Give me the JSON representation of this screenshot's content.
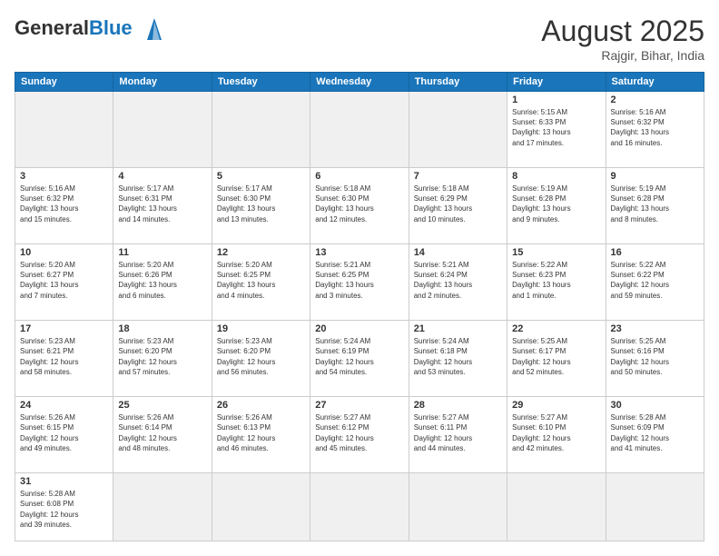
{
  "header": {
    "logo_general": "General",
    "logo_blue": "Blue",
    "month_title": "August 2025",
    "location": "Rajgir, Bihar, India"
  },
  "weekdays": [
    "Sunday",
    "Monday",
    "Tuesday",
    "Wednesday",
    "Thursday",
    "Friday",
    "Saturday"
  ],
  "days": {
    "1": {
      "sunrise": "5:15 AM",
      "sunset": "6:33 PM",
      "daylight": "13 hours and 17 minutes."
    },
    "2": {
      "sunrise": "5:16 AM",
      "sunset": "6:32 PM",
      "daylight": "13 hours and 16 minutes."
    },
    "3": {
      "sunrise": "5:16 AM",
      "sunset": "6:32 PM",
      "daylight": "13 hours and 15 minutes."
    },
    "4": {
      "sunrise": "5:17 AM",
      "sunset": "6:31 PM",
      "daylight": "13 hours and 14 minutes."
    },
    "5": {
      "sunrise": "5:17 AM",
      "sunset": "6:30 PM",
      "daylight": "13 hours and 13 minutes."
    },
    "6": {
      "sunrise": "5:18 AM",
      "sunset": "6:30 PM",
      "daylight": "13 hours and 12 minutes."
    },
    "7": {
      "sunrise": "5:18 AM",
      "sunset": "6:29 PM",
      "daylight": "13 hours and 10 minutes."
    },
    "8": {
      "sunrise": "5:19 AM",
      "sunset": "6:28 PM",
      "daylight": "13 hours and 9 minutes."
    },
    "9": {
      "sunrise": "5:19 AM",
      "sunset": "6:28 PM",
      "daylight": "13 hours and 8 minutes."
    },
    "10": {
      "sunrise": "5:20 AM",
      "sunset": "6:27 PM",
      "daylight": "13 hours and 7 minutes."
    },
    "11": {
      "sunrise": "5:20 AM",
      "sunset": "6:26 PM",
      "daylight": "13 hours and 6 minutes."
    },
    "12": {
      "sunrise": "5:20 AM",
      "sunset": "6:25 PM",
      "daylight": "13 hours and 4 minutes."
    },
    "13": {
      "sunrise": "5:21 AM",
      "sunset": "6:25 PM",
      "daylight": "13 hours and 3 minutes."
    },
    "14": {
      "sunrise": "5:21 AM",
      "sunset": "6:24 PM",
      "daylight": "13 hours and 2 minutes."
    },
    "15": {
      "sunrise": "5:22 AM",
      "sunset": "6:23 PM",
      "daylight": "13 hours and 1 minute."
    },
    "16": {
      "sunrise": "5:22 AM",
      "sunset": "6:22 PM",
      "daylight": "12 hours and 59 minutes."
    },
    "17": {
      "sunrise": "5:23 AM",
      "sunset": "6:21 PM",
      "daylight": "12 hours and 58 minutes."
    },
    "18": {
      "sunrise": "5:23 AM",
      "sunset": "6:20 PM",
      "daylight": "12 hours and 57 minutes."
    },
    "19": {
      "sunrise": "5:23 AM",
      "sunset": "6:20 PM",
      "daylight": "12 hours and 56 minutes."
    },
    "20": {
      "sunrise": "5:24 AM",
      "sunset": "6:19 PM",
      "daylight": "12 hours and 54 minutes."
    },
    "21": {
      "sunrise": "5:24 AM",
      "sunset": "6:18 PM",
      "daylight": "12 hours and 53 minutes."
    },
    "22": {
      "sunrise": "5:25 AM",
      "sunset": "6:17 PM",
      "daylight": "12 hours and 52 minutes."
    },
    "23": {
      "sunrise": "5:25 AM",
      "sunset": "6:16 PM",
      "daylight": "12 hours and 50 minutes."
    },
    "24": {
      "sunrise": "5:26 AM",
      "sunset": "6:15 PM",
      "daylight": "12 hours and 49 minutes."
    },
    "25": {
      "sunrise": "5:26 AM",
      "sunset": "6:14 PM",
      "daylight": "12 hours and 48 minutes."
    },
    "26": {
      "sunrise": "5:26 AM",
      "sunset": "6:13 PM",
      "daylight": "12 hours and 46 minutes."
    },
    "27": {
      "sunrise": "5:27 AM",
      "sunset": "6:12 PM",
      "daylight": "12 hours and 45 minutes."
    },
    "28": {
      "sunrise": "5:27 AM",
      "sunset": "6:11 PM",
      "daylight": "12 hours and 44 minutes."
    },
    "29": {
      "sunrise": "5:27 AM",
      "sunset": "6:10 PM",
      "daylight": "12 hours and 42 minutes."
    },
    "30": {
      "sunrise": "5:28 AM",
      "sunset": "6:09 PM",
      "daylight": "12 hours and 41 minutes."
    },
    "31": {
      "sunrise": "5:28 AM",
      "sunset": "6:08 PM",
      "daylight": "12 hours and 39 minutes."
    }
  }
}
